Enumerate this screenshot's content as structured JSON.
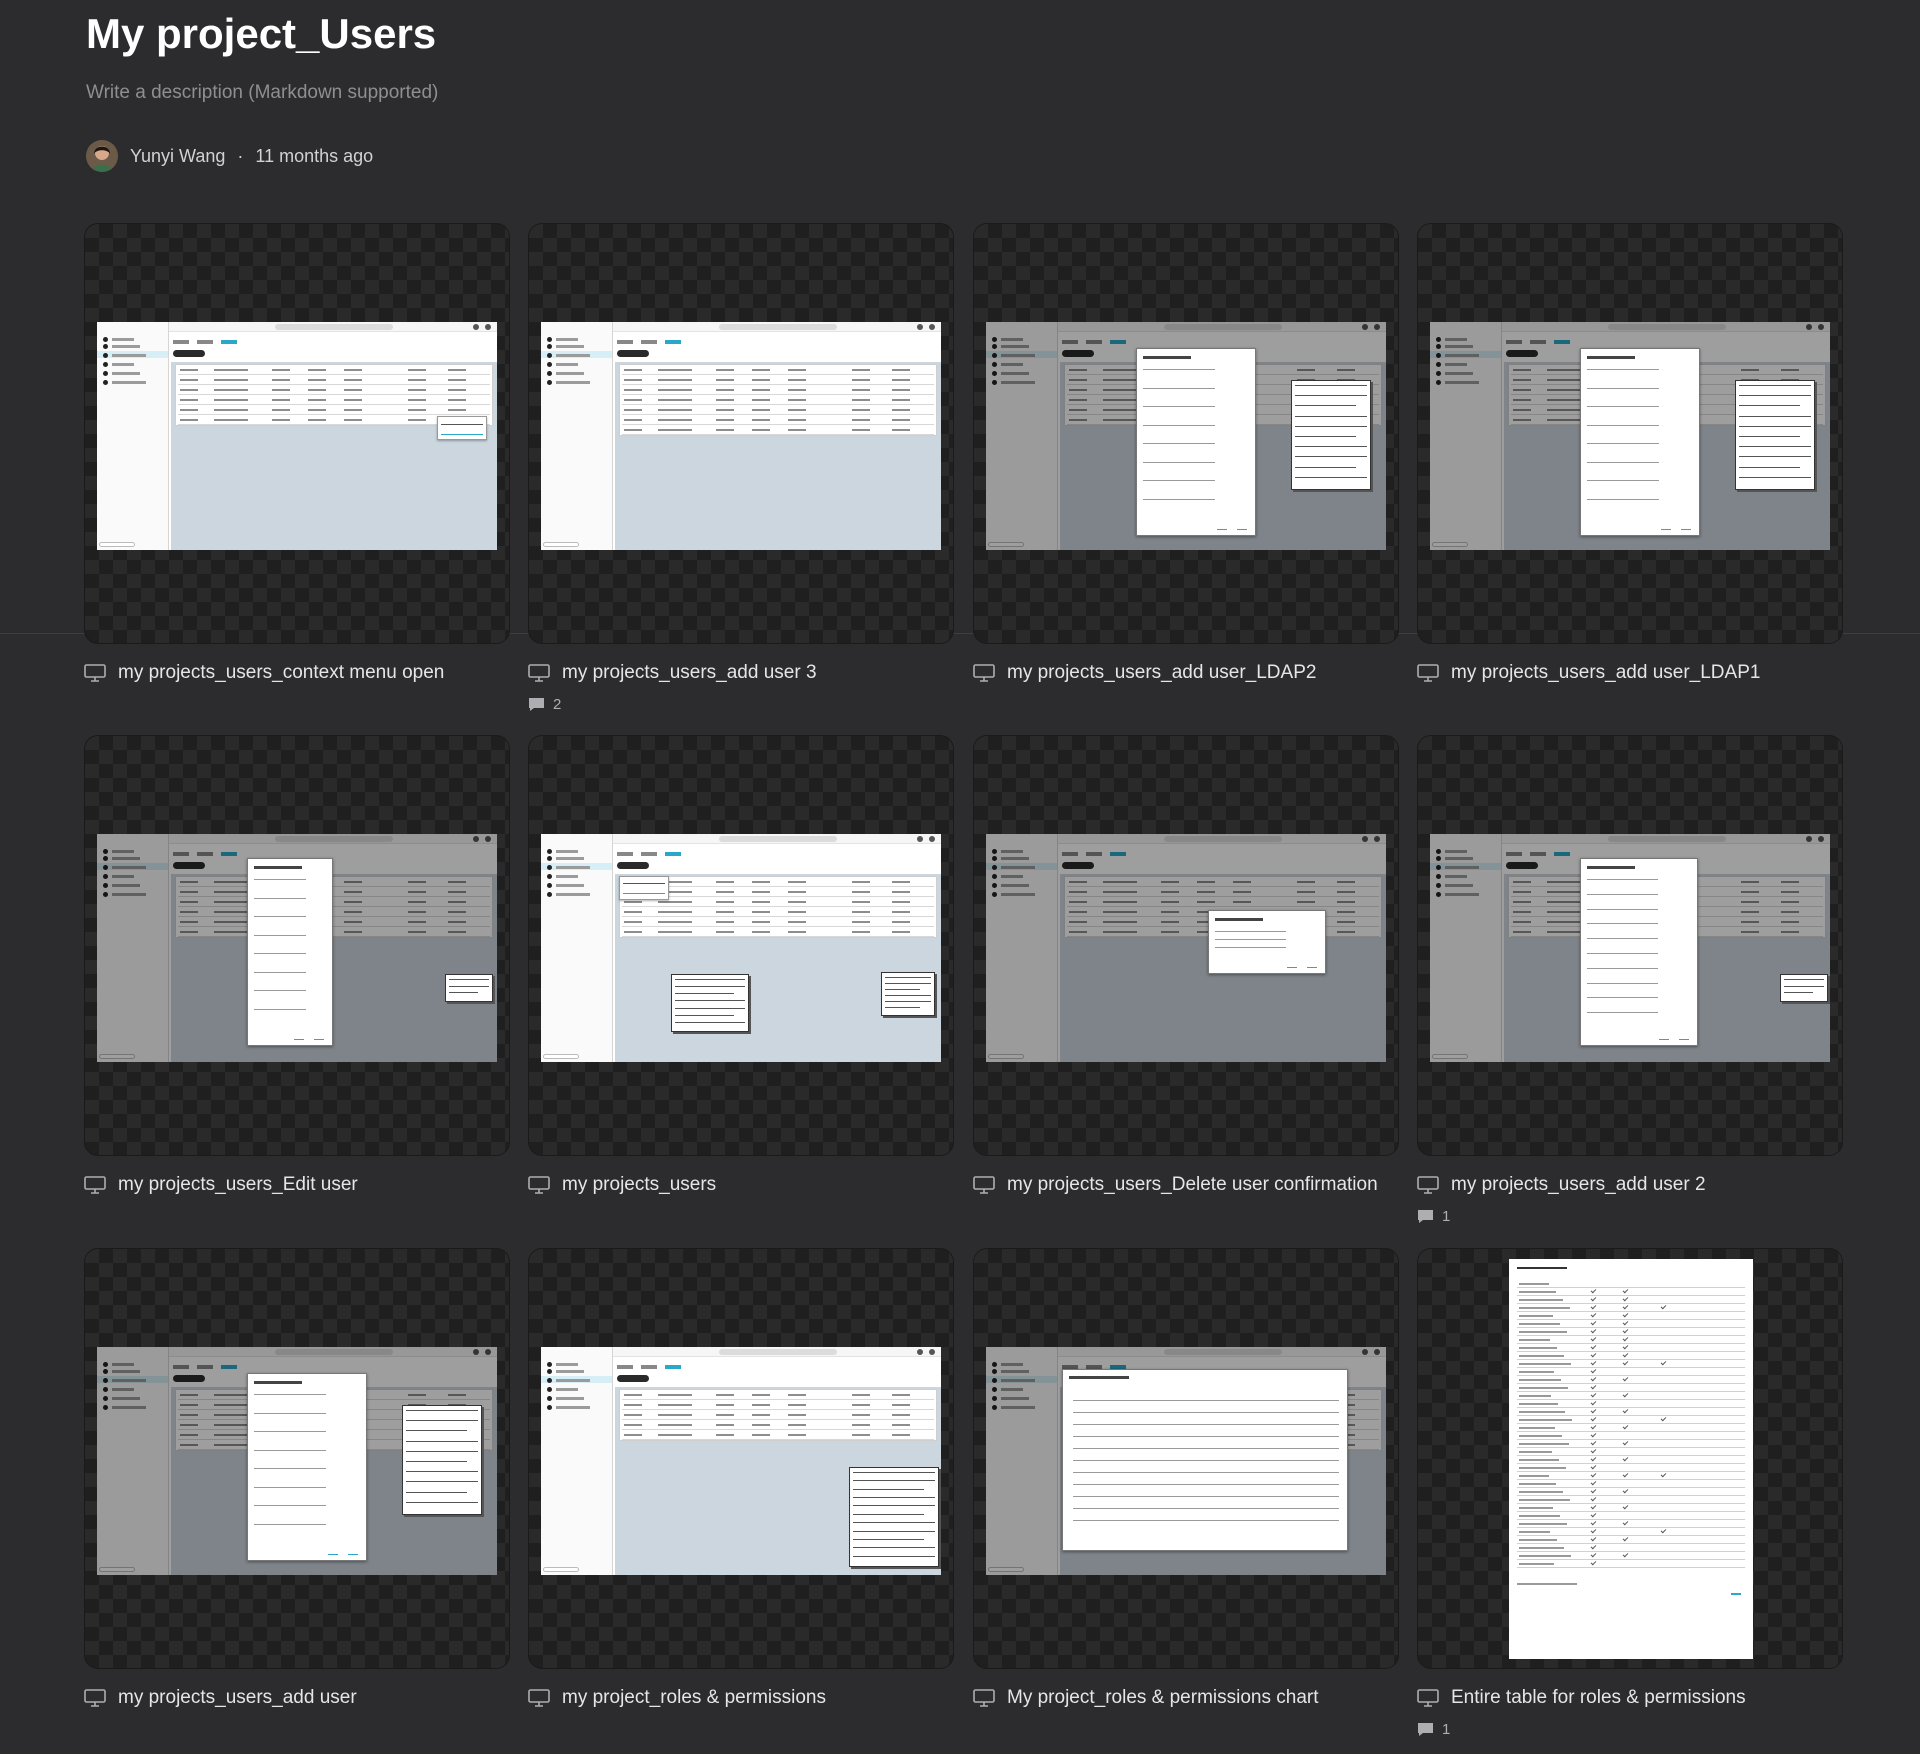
{
  "header": {
    "title": "My project_Users",
    "description_placeholder": "Write a description (Markdown supported)",
    "author": "Yunyi Wang",
    "separator": "·",
    "time": "11 months ago"
  },
  "cards": [
    {
      "title": "my projects_users_context menu open",
      "comments": "",
      "variant": "context"
    },
    {
      "title": "my projects_users_add user 3",
      "comments": "2",
      "variant": "plain"
    },
    {
      "title": "my projects_users_add user_LDAP2",
      "comments": "",
      "variant": "ldap"
    },
    {
      "title": "my projects_users_add user_LDAP1",
      "comments": "",
      "variant": "ldap"
    },
    {
      "title": "my projects_users_Edit user",
      "comments": "",
      "variant": "edit"
    },
    {
      "title": "my projects_users",
      "comments": "",
      "variant": "menu"
    },
    {
      "title": "my projects_users_Delete user confirmation",
      "comments": "",
      "variant": "delete"
    },
    {
      "title": "my projects_users_add user 2",
      "comments": "1",
      "variant": "add2"
    },
    {
      "title": "my projects_users_add user",
      "comments": "",
      "variant": "ldap"
    },
    {
      "title": "my project_roles & permissions",
      "comments": "",
      "variant": "roles"
    },
    {
      "title": "My project_roles & permissions chart",
      "comments": "",
      "variant": "chart"
    },
    {
      "title": "Entire table for roles & permissions",
      "comments": "1",
      "variant": "doc"
    }
  ],
  "colors": {
    "background": "#2c2c2e",
    "accent": "#2aa8c7",
    "text": "#ffffff",
    "muted": "#8e8e93"
  },
  "icons": {
    "caption": "screen-icon",
    "comments": "comment-icon"
  }
}
